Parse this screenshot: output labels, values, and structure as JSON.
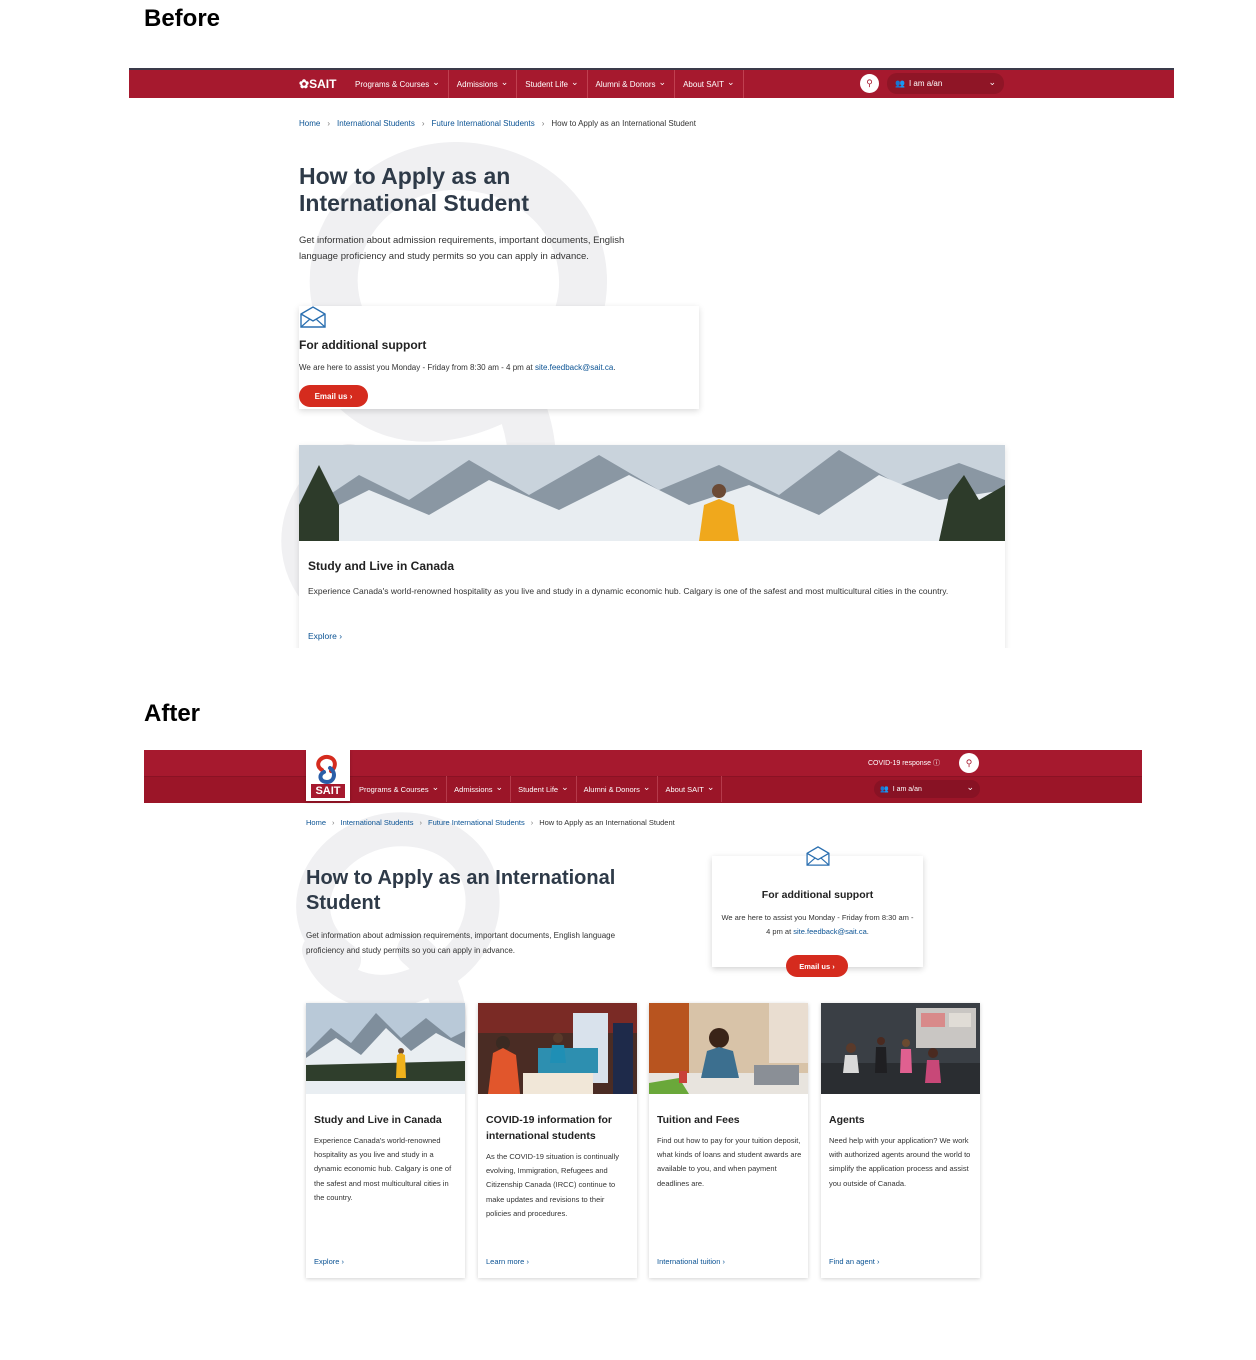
{
  "labels": {
    "before": "Before",
    "after": "After"
  },
  "before": {
    "logo": "SAIT",
    "menu": [
      "Programs & Courses",
      "Admissions",
      "Student Life",
      "Alumni & Donors",
      "About SAIT"
    ],
    "iam": "I am a/an",
    "breadcrumb": [
      "Home",
      "International Students",
      "Future International Students",
      "How to Apply as an International Student"
    ],
    "title": "How to Apply as an International Student",
    "intro": "Get information about admission requirements, important documents, English language proficiency and study permits so you can apply in advance.",
    "support": {
      "heading": "For additional support",
      "text": "We are here to assist you Monday - Friday from 8:30 am - 4 pm at ",
      "email": "site.feedback@sait.ca",
      "text_end": ".",
      "button": "Email us"
    },
    "card": {
      "heading": "Study and Live in Canada",
      "text": "Experience Canada's world-renowned hospitality as you live and study in a dynamic economic hub. Calgary is one of the safest and most multicultural cities in the country.",
      "link": "Explore"
    }
  },
  "after": {
    "logo": "SAIT",
    "covid": "COVID-19 response",
    "menu": [
      "Programs & Courses",
      "Admissions",
      "Student Life",
      "Alumni & Donors",
      "About SAIT"
    ],
    "iam": "I am a/an",
    "breadcrumb": [
      "Home",
      "International Students",
      "Future International Students",
      "How to Apply as an International Student"
    ],
    "title": "How to Apply as an International Student",
    "intro": "Get information about admission requirements, important documents, English language proficiency and study permits so you can apply in advance.",
    "support": {
      "heading": "For additional support",
      "text": "We are here to assist you Monday - Friday from 8:30 am - 4 pm at ",
      "email": "site.feedback@sait.ca",
      "text_end": ".",
      "button": "Email us"
    },
    "cards": [
      {
        "heading": "Study and Live in Canada",
        "text": "Experience Canada's world-renowned hospitality as you live and study in a dynamic economic hub. Calgary is one of the safest and most multicultural cities in the country.",
        "link": "Explore"
      },
      {
        "heading": "COVID-19 information for international students",
        "text": "As the COVID-19 situation is continually evolving, Immigration, Refugees and Citizenship Canada (IRCC) continue to make updates and revisions to their policies and procedures.",
        "link": "Learn more"
      },
      {
        "heading": "Tuition and Fees",
        "text": "Find out how to pay for your tuition deposit, what kinds of loans and student awards are available to you, and when payment deadlines are.",
        "link": "International tuition"
      },
      {
        "heading": "Agents",
        "text": "Need help with your application? We work with authorized agents around the world to simplify the application process and assist you outside of Canada.",
        "link": "Find an agent"
      }
    ]
  },
  "colors": {
    "brand_red": "#a6192e",
    "button_red": "#d52b1e",
    "link_blue": "#0b5394",
    "title_navy": "#2e3a48"
  }
}
